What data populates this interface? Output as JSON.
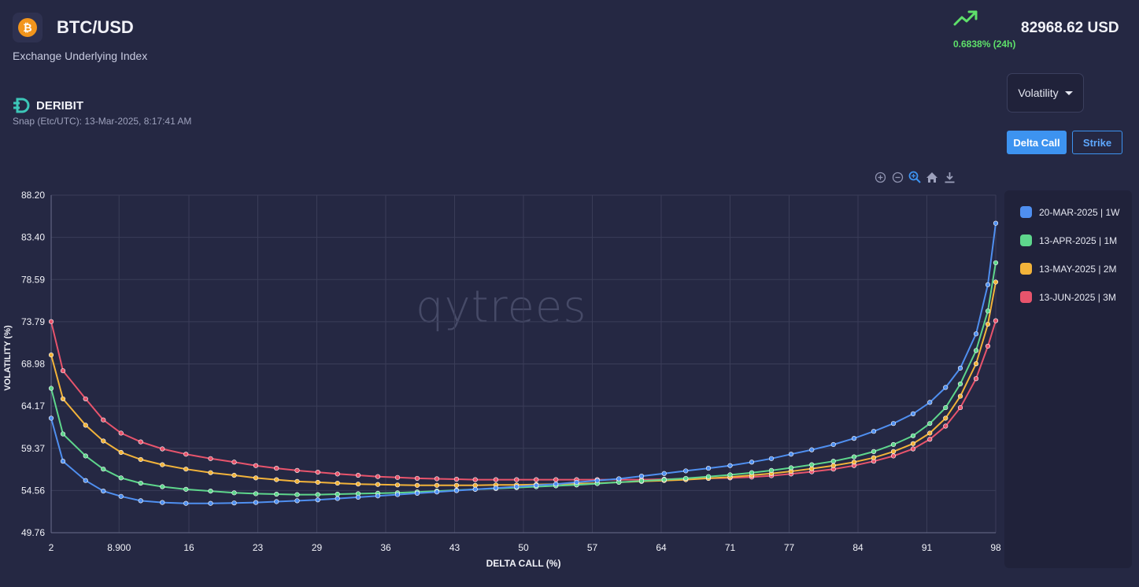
{
  "header": {
    "pair": "BTC/USD",
    "coin_symbol": "₿",
    "subtitle": "Exchange Underlying Index",
    "change": "0.6838% (24h)",
    "price": "82968.62 USD"
  },
  "exchange": {
    "name": "DERIBIT",
    "snap": "Snap (Etc/UTC): 13-Mar-2025, 8:17:41 AM"
  },
  "controls": {
    "dropdown_label": "Volatility",
    "delta_call_label": "Delta Call",
    "strike_label": "Strike"
  },
  "watermark": "qytrees",
  "colors": {
    "background": "#252843",
    "accent": "#3d93f0",
    "up": "#5ee06a"
  },
  "chart_data": {
    "type": "line",
    "xlabel": "DELTA CALL (%)",
    "ylabel": "VOLATILITY (%)",
    "xlim": [
      2,
      98
    ],
    "ylim": [
      49.76,
      88.2
    ],
    "x_ticks": [
      "2",
      "8.900",
      "16",
      "23",
      "29",
      "36",
      "43",
      "50",
      "57",
      "64",
      "71",
      "77",
      "84",
      "91",
      "98"
    ],
    "y_ticks": [
      "88.20",
      "83.40",
      "78.59",
      "73.79",
      "68.98",
      "64.17",
      "59.37",
      "54.56",
      "49.76"
    ],
    "grid": true,
    "legend_position": "right",
    "x": [
      2,
      3.2,
      5.5,
      7.3,
      9.1,
      11.1,
      13.3,
      15.7,
      18.2,
      20.6,
      22.8,
      24.9,
      27.0,
      29.1,
      31.1,
      33.2,
      35.2,
      37.2,
      39.2,
      41.2,
      43.2,
      45.1,
      47.2,
      49.3,
      51.3,
      53.3,
      55.4,
      57.5,
      59.7,
      62.0,
      64.3,
      66.5,
      68.8,
      71.0,
      73.2,
      75.2,
      77.2,
      79.3,
      81.5,
      83.6,
      85.6,
      87.6,
      89.6,
      91.3,
      92.9,
      94.4,
      96.0,
      97.2,
      98
    ],
    "series": [
      {
        "name": "20-MAR-2025 | 1W",
        "color": "#4f8ff0",
        "values": [
          62.8,
          57.9,
          55.7,
          54.5,
          53.9,
          53.4,
          53.2,
          53.1,
          53.1,
          53.15,
          53.2,
          53.3,
          53.4,
          53.5,
          53.65,
          53.8,
          53.95,
          54.1,
          54.25,
          54.4,
          54.55,
          54.7,
          54.85,
          55.0,
          55.15,
          55.3,
          55.5,
          55.7,
          55.9,
          56.2,
          56.5,
          56.8,
          57.1,
          57.4,
          57.8,
          58.2,
          58.7,
          59.2,
          59.8,
          60.5,
          61.3,
          62.2,
          63.3,
          64.6,
          66.3,
          68.5,
          72.4,
          78.0,
          85.0
        ]
      },
      {
        "name": "13-APR-2025 | 1M",
        "color": "#5ed68c",
        "values": [
          66.2,
          61.0,
          58.5,
          57.0,
          56.0,
          55.4,
          55.0,
          54.7,
          54.5,
          54.3,
          54.2,
          54.15,
          54.1,
          54.1,
          54.15,
          54.2,
          54.25,
          54.3,
          54.4,
          54.5,
          54.6,
          54.7,
          54.8,
          54.9,
          55.0,
          55.1,
          55.2,
          55.35,
          55.5,
          55.65,
          55.8,
          55.95,
          56.15,
          56.35,
          56.6,
          56.85,
          57.15,
          57.5,
          57.9,
          58.4,
          59.0,
          59.8,
          60.8,
          62.2,
          64.0,
          66.7,
          70.5,
          75.0,
          80.5
        ]
      },
      {
        "name": "13-MAY-2025 | 2M",
        "color": "#f2b33a",
        "values": [
          70.0,
          65.0,
          62.0,
          60.2,
          58.9,
          58.1,
          57.5,
          57.0,
          56.6,
          56.3,
          56.0,
          55.8,
          55.6,
          55.5,
          55.4,
          55.3,
          55.25,
          55.2,
          55.15,
          55.15,
          55.15,
          55.15,
          55.2,
          55.2,
          55.25,
          55.3,
          55.35,
          55.4,
          55.5,
          55.6,
          55.7,
          55.8,
          55.95,
          56.1,
          56.3,
          56.5,
          56.75,
          57.05,
          57.4,
          57.8,
          58.3,
          59.0,
          59.9,
          61.1,
          62.8,
          65.3,
          69.0,
          73.5,
          78.3
        ]
      },
      {
        "name": "13-JUN-2025 | 3M",
        "color": "#e8546c",
        "values": [
          73.8,
          68.2,
          65.0,
          62.6,
          61.1,
          60.1,
          59.3,
          58.7,
          58.2,
          57.8,
          57.4,
          57.1,
          56.85,
          56.65,
          56.45,
          56.3,
          56.15,
          56.05,
          55.95,
          55.9,
          55.85,
          55.8,
          55.8,
          55.8,
          55.8,
          55.8,
          55.8,
          55.8,
          55.8,
          55.8,
          55.85,
          55.9,
          55.95,
          56.0,
          56.1,
          56.25,
          56.45,
          56.7,
          57.0,
          57.4,
          57.9,
          58.5,
          59.3,
          60.4,
          61.9,
          64.0,
          67.3,
          71.0,
          73.9
        ]
      }
    ]
  }
}
